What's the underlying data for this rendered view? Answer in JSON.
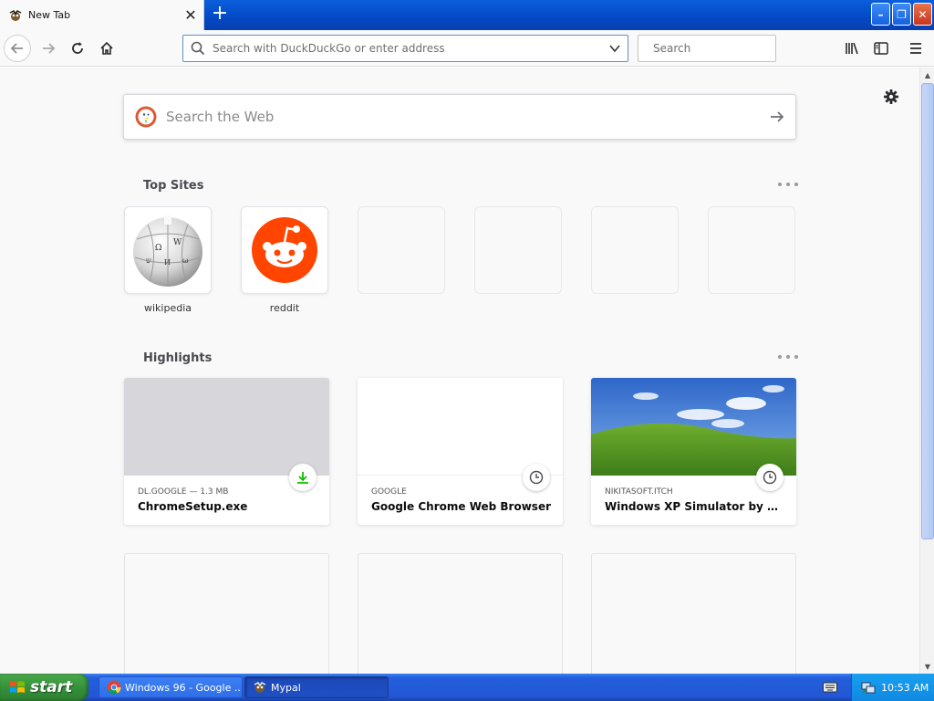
{
  "browser": {
    "tab": {
      "title": "New Tab",
      "close_glyph": "✕"
    },
    "newtab_glyph": "+",
    "window_buttons": {
      "minimize": "–",
      "restore": "❐",
      "close": "✕"
    },
    "urlbar": {
      "placeholder": "Search with DuckDuckGo or enter address"
    },
    "searchbar": {
      "placeholder": "Search"
    }
  },
  "newtab": {
    "web_search": {
      "placeholder": "Search the Web"
    },
    "top_sites": {
      "title": "Top Sites",
      "items": [
        {
          "label": "wikipedia"
        },
        {
          "label": "reddit"
        },
        {
          "label": ""
        },
        {
          "label": ""
        },
        {
          "label": ""
        },
        {
          "label": ""
        }
      ]
    },
    "highlights": {
      "title": "Highlights",
      "items": [
        {
          "source": "DL.GOOGLE — 1.3 MB",
          "title": "ChromeSetup.exe",
          "badge": "download-icon"
        },
        {
          "source": "GOOGLE",
          "title": "Google Chrome Web Browser",
          "badge": "clock-icon"
        },
        {
          "source": "NIKITASOFT.ITCH",
          "title": "Windows XP Simulator by Nikita...",
          "badge": "clock-icon"
        }
      ]
    }
  },
  "taskbar": {
    "start_label": "start",
    "tasks": [
      {
        "label": "Windows 96 - Google ...",
        "icon": "chrome-icon"
      },
      {
        "label": "Mypal",
        "icon": "mypal-icon"
      }
    ],
    "clock": "10:53 AM"
  },
  "colors": {
    "titlebar_blue": "#0548c4",
    "reddit_orange": "#ff4500",
    "download_green": "#12bc00",
    "start_green": "#35923a"
  }
}
